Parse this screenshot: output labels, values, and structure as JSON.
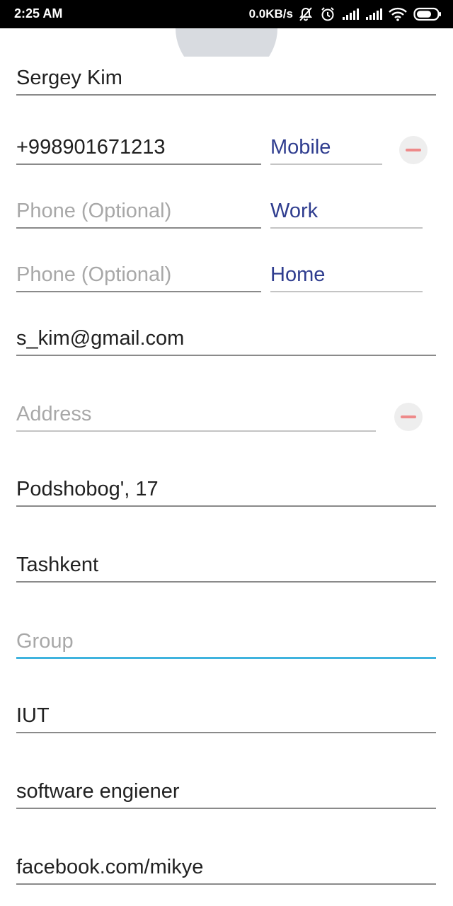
{
  "status_bar": {
    "time": "2:25 AM",
    "net_speed": "0.0KB/s",
    "icons": [
      "mute-alarm-icon",
      "alarm-clock-icon",
      "signal-icon",
      "signal-icon-2",
      "wifi-icon",
      "battery-icon"
    ]
  },
  "contact": {
    "name": "Sergey Kim",
    "phones": [
      {
        "value": "+998901671213",
        "placeholder": "Phone (Optional)",
        "type": "Mobile"
      },
      {
        "value": "",
        "placeholder": "Phone (Optional)",
        "type": "Work"
      },
      {
        "value": "",
        "placeholder": "Phone (Optional)",
        "type": "Home"
      }
    ],
    "email": "s_kim@gmail.com",
    "address_placeholder": "Address",
    "street": "Podshobog', 17",
    "city": "Tashkent",
    "group_placeholder": "Group",
    "company": "IUT",
    "title": "software engiener",
    "website": "facebook.com/mikye"
  },
  "colors": {
    "accent_focus": "#3fb3de",
    "type_text": "#2f3d8f",
    "remove_icon": "#ee8a8a",
    "avatar_bg": "#d8dbe0"
  }
}
